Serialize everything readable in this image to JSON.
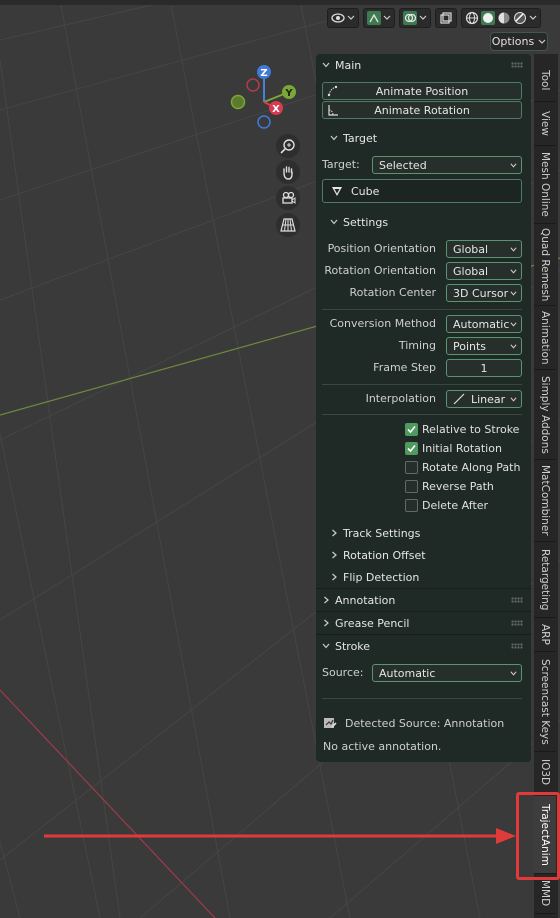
{
  "header": {
    "options_label": "Options",
    "icons": [
      "view-object-types-icon",
      "gizmo-icon",
      "overlays-icon",
      "xray-icon",
      "shading-wireframe-icon",
      "shading-solid-icon",
      "shading-material-icon",
      "shading-rendered-icon"
    ]
  },
  "gizmo": {
    "x_label": "X",
    "y_label": "Y",
    "z_label": "Z"
  },
  "panel": {
    "main": {
      "title": "Main",
      "animate_position": "Animate Position",
      "animate_rotation": "Animate Rotation"
    },
    "target": {
      "title": "Target",
      "target_label": "Target:",
      "target_value": "Selected",
      "object_name": "Cube"
    },
    "settings": {
      "title": "Settings",
      "position_orientation_label": "Position Orientation",
      "position_orientation_value": "Global",
      "rotation_orientation_label": "Rotation Orientation",
      "rotation_orientation_value": "Global",
      "rotation_center_label": "Rotation Center",
      "rotation_center_value": "3D Cursor",
      "conversion_method_label": "Conversion Method",
      "conversion_method_value": "Automatic",
      "timing_label": "Timing",
      "timing_value": "Points",
      "frame_step_label": "Frame Step",
      "frame_step_value": "1",
      "interpolation_label": "Interpolation",
      "interpolation_value": "Linear",
      "checkboxes": [
        {
          "label": "Relative to Stroke",
          "checked": true
        },
        {
          "label": "Initial Rotation",
          "checked": true
        },
        {
          "label": "Rotate Along Path",
          "checked": false
        },
        {
          "label": "Reverse Path",
          "checked": false
        },
        {
          "label": "Delete After",
          "checked": false
        }
      ],
      "track_settings": "Track Settings",
      "rotation_offset": "Rotation Offset",
      "flip_detection": "Flip Detection"
    },
    "annotation": {
      "title": "Annotation"
    },
    "grease_pencil": {
      "title": "Grease Pencil"
    },
    "stroke": {
      "title": "Stroke",
      "source_label": "Source:",
      "source_value": "Automatic",
      "detected_source": "Detected Source: Annotation",
      "no_active": "No active annotation."
    }
  },
  "tabs": [
    "Tool",
    "View",
    "Mesh Online",
    "Quad Remesh",
    "Animation",
    "Simply Addons",
    "MatCombiner",
    "Retargeting",
    "ARP",
    "Screencast Keys",
    "IO3D",
    "TrajectAnim",
    "MMD"
  ],
  "active_tab": "TrajectAnim",
  "colors": {
    "accent_green": "#4e9a5f",
    "highlight_red": "#e03a3a",
    "panel_bg": "#1f2a26"
  }
}
